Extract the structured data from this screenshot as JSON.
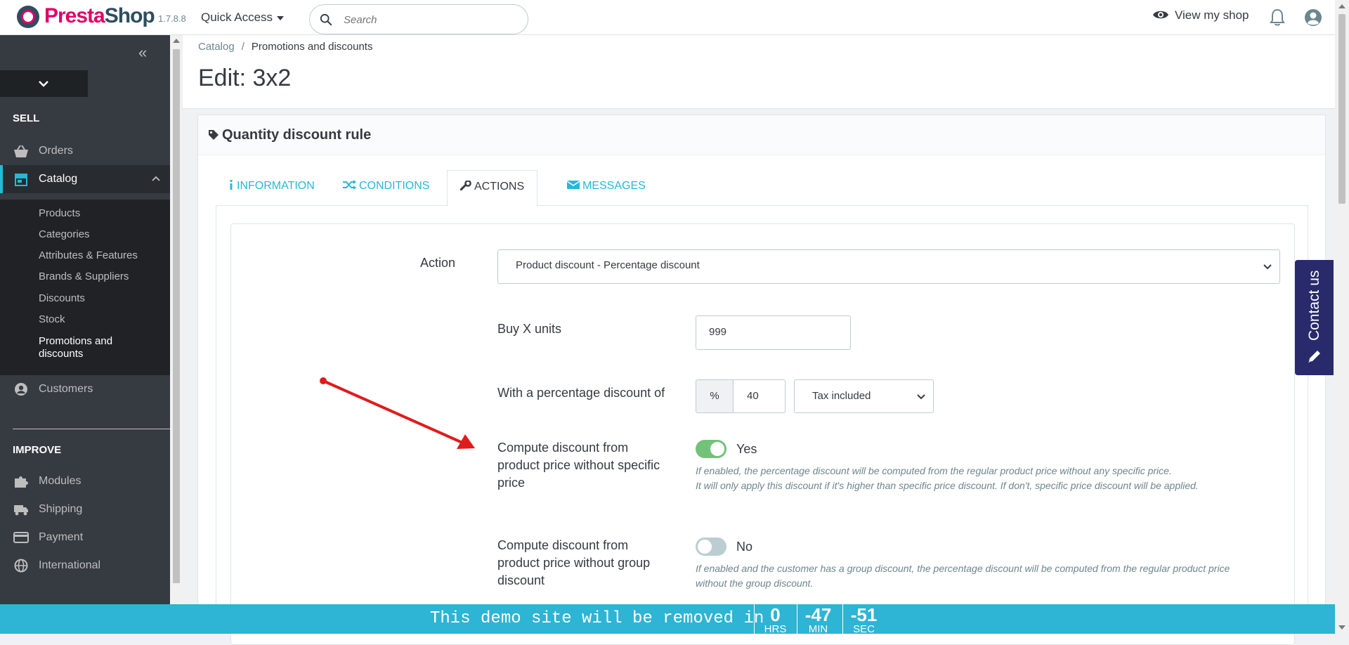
{
  "header": {
    "brand_part1": "Presta",
    "brand_part2": "Shop",
    "version": "1.7.8.8",
    "quick_access": "Quick Access",
    "search_placeholder": "Search",
    "view_shop": "View my shop"
  },
  "sidebar": {
    "collapse": "«",
    "sections": {
      "sell": "SELL",
      "improve": "IMPROVE"
    },
    "items": {
      "orders": "Orders",
      "catalog": "Catalog",
      "customers": "Customers",
      "modules": "Modules",
      "shipping": "Shipping",
      "payment": "Payment",
      "international": "International"
    },
    "catalog_sub": [
      "Products",
      "Categories",
      "Attributes & Features",
      "Brands & Suppliers",
      "Discounts",
      "Stock",
      "Promotions and",
      "discounts"
    ]
  },
  "main": {
    "breadcrumb": {
      "parent": "Catalog",
      "sep": "/",
      "current": "Promotions and discounts"
    },
    "page_title": "Edit: 3x2",
    "panel_title": "Quantity discount rule",
    "tabs": {
      "information": "INFORMATION",
      "conditions": "CONDITIONS",
      "actions": "ACTIONS",
      "messages": "MESSAGES"
    },
    "form": {
      "action_label": "Action",
      "action_value": "Product discount - Percentage discount",
      "buyx_label": "Buy X units",
      "buyx_value": "999",
      "pct_label": "With a percentage discount of",
      "pct_addon": "%",
      "pct_value": "40",
      "tax_value": "Tax included",
      "compute_specific_label": [
        "Compute discount from",
        "product price without specific",
        "price"
      ],
      "compute_specific_state": "Yes",
      "compute_specific_help": [
        "If enabled, the percentage discount will be computed from the regular product price without any specific price.",
        "It will only apply this discount if it's higher than specific price discount. If don't, specific price discount will be applied."
      ],
      "compute_group_label": [
        "Compute discount from",
        "product price without group",
        "discount"
      ],
      "compute_group_state": "No",
      "compute_group_help": [
        "If enabled and the customer has a group discount, the percentage discount will be computed from the regular product price",
        "without the group discount."
      ]
    }
  },
  "contact_tab": "Contact us",
  "demo_banner": {
    "text": "This demo site will be removed in",
    "hours": "0",
    "hours_unit": "HRS",
    "minutes": "-47",
    "minutes_unit": "MIN",
    "seconds": "-51",
    "seconds_unit": "SEC"
  },
  "colors": {
    "accent": "#25b9d7",
    "brand": "#df0067",
    "sidebar": "#363a41",
    "switch_on": "#72c279",
    "banner": "#2eb4d4",
    "arrow": "#e01b1b"
  }
}
